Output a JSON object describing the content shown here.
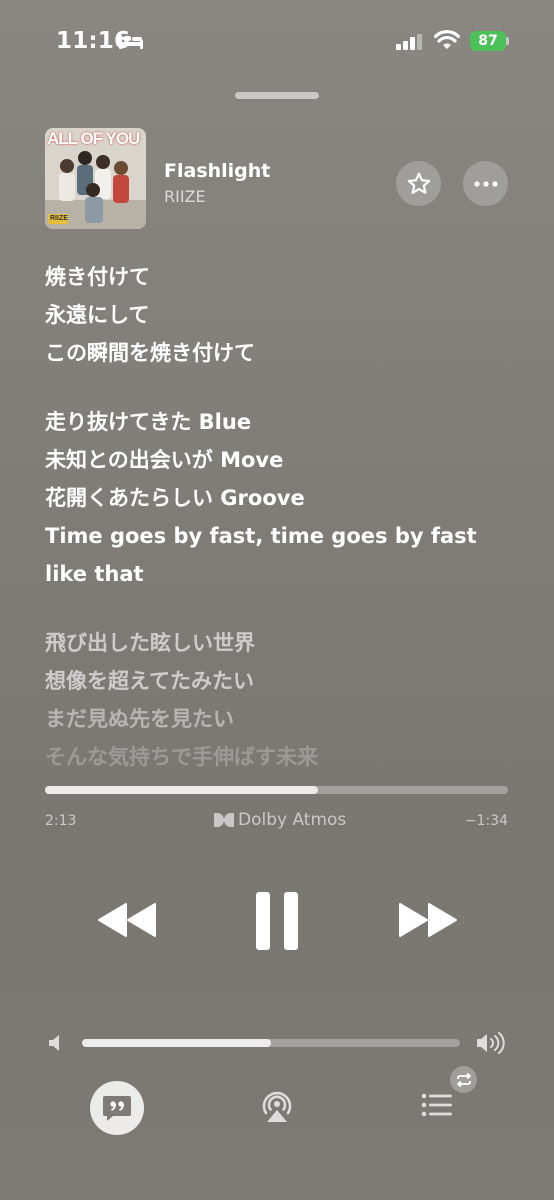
{
  "status_bar": {
    "time": "11:16",
    "battery": "87"
  },
  "now_playing": {
    "title": "Flashlight",
    "artist": "RIIZE",
    "album_art_text": "ALL OF YOU",
    "album_art_label": "RIIZE"
  },
  "lyrics": [
    {
      "text": "焼き付けて"
    },
    {
      "text": "永遠にして"
    },
    {
      "text": "この瞬間を焼き付けて"
    },
    {
      "text": "走り抜けてきた Blue"
    },
    {
      "text": "未知との出会いが Move"
    },
    {
      "text": "花開くあたらしい Groove"
    },
    {
      "text": "Time goes by fast, time goes by fast"
    },
    {
      "text": "like that"
    },
    {
      "text": "飛び出した眩しい世界"
    },
    {
      "text": "想像を超えてたみたい"
    },
    {
      "text": "まだ見ぬ先を見たい"
    },
    {
      "text": "そんな気持ちで手伸ばす未来"
    }
  ],
  "playback": {
    "elapsed": "2:13",
    "remaining": "−1:34",
    "progress_fraction": 0.59,
    "audio_format": "Dolby Atmos"
  },
  "volume": {
    "level_fraction": 0.5
  },
  "icons": {
    "bed": "sleep-focus-icon",
    "signal": "cellular-signal-icon",
    "wifi": "wifi-icon",
    "star": "star-icon",
    "more": "ellipsis-icon",
    "rewind": "rewind-icon",
    "pause": "pause-icon",
    "forward": "fast-forward-icon",
    "volume_low": "speaker-low-icon",
    "volume_high": "speaker-high-icon",
    "lyrics": "lyrics-quote-icon",
    "airplay": "airplay-icon",
    "queue": "queue-list-icon",
    "repeat": "repeat-icon"
  },
  "colors": {
    "battery": "#4cc15a"
  }
}
